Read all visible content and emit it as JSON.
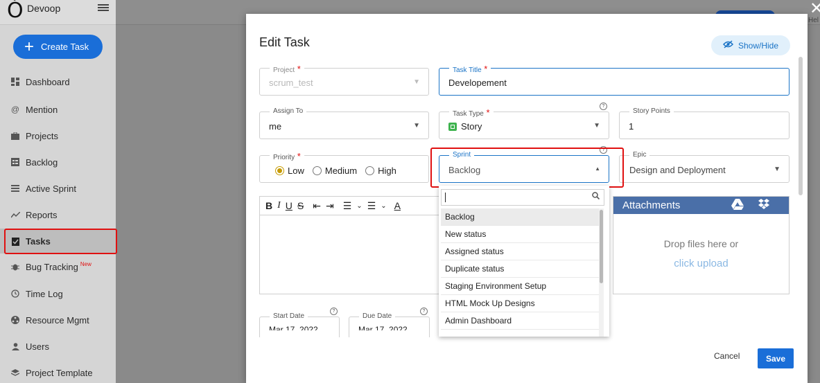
{
  "sidebar": {
    "brand": "Devoop",
    "logo_glyph": "Ó",
    "create_task": "Create Task",
    "items": [
      {
        "label": "Dashboard",
        "icon": "dashboard-icon"
      },
      {
        "label": "Mention",
        "icon": "at-icon"
      },
      {
        "label": "Projects",
        "icon": "briefcase-icon"
      },
      {
        "label": "Backlog",
        "icon": "backlog-icon"
      },
      {
        "label": "Active Sprint",
        "icon": "list-icon"
      },
      {
        "label": "Reports",
        "icon": "trend-icon"
      },
      {
        "label": "Tasks",
        "icon": "clipboard-icon",
        "active": true
      },
      {
        "label": "Bug Tracking",
        "icon": "bug-icon",
        "badge": "New"
      },
      {
        "label": "Time Log",
        "icon": "clock-icon"
      },
      {
        "label": "Resource Mgmt",
        "icon": "resource-icon"
      },
      {
        "label": "Users",
        "icon": "user-icon"
      },
      {
        "label": "Project Template",
        "icon": "layers-icon"
      }
    ]
  },
  "header": {
    "help": "Hel"
  },
  "modal": {
    "title": "Edit Task",
    "show_hide": "Show/Hide",
    "project": {
      "label": "Project",
      "value": "scrum_test"
    },
    "task_title": {
      "label": "Task Title",
      "value": "Developement"
    },
    "assign_to": {
      "label": "Assign To",
      "value": "me"
    },
    "task_type": {
      "label": "Task Type",
      "value": "Story"
    },
    "story_points": {
      "label": "Story Points",
      "value": "1"
    },
    "priority": {
      "label": "Priority",
      "options": [
        "Low",
        "Medium",
        "High"
      ],
      "selected": "Low"
    },
    "sprint": {
      "label": "Sprint",
      "value": "Backlog"
    },
    "epic": {
      "label": "Epic",
      "value": "Design and Deployment"
    },
    "attachments": {
      "title": "Attachments",
      "drop_text": "Drop files here or",
      "upload_text": "click upload"
    },
    "start_date": {
      "label": "Start Date",
      "value": "Mar 17, 2022"
    },
    "due_date": {
      "label": "Due Date",
      "value": "Mar 17, 2022"
    },
    "cancel": "Cancel",
    "save": "Save"
  },
  "sprint_dropdown": {
    "options": [
      "Backlog",
      "New status",
      "Assigned status",
      "Duplicate status",
      "Staging Environment Setup",
      "HTML Mock Up Designs",
      "Admin Dashboard"
    ],
    "selected": "Backlog"
  },
  "colors": {
    "accent": "#1a6ed8",
    "highlight": "#e01010",
    "radio_selected": "#c59a00",
    "attachments_header": "#4a6fa8"
  }
}
